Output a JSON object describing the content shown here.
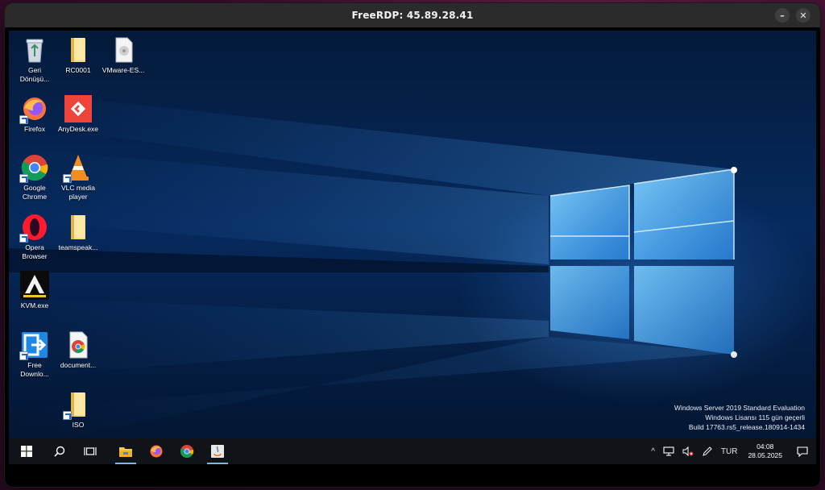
{
  "window": {
    "title": "FreeRDP: 45.89.28.41",
    "minimize_glyph": "–",
    "close_glyph": "✕"
  },
  "desktop_icons": [
    {
      "name": "recycle-bin-icon",
      "lines": [
        "Geri",
        "Dönüşü..."
      ]
    },
    {
      "name": "folder-icon",
      "lines": [
        "RC0001"
      ]
    },
    {
      "name": "file-icon",
      "lines": [
        "VMware-ES..."
      ]
    },
    {
      "name": "firefox-icon",
      "lines": [
        "Firefox"
      ]
    },
    {
      "name": "anydesk-icon",
      "lines": [
        "AnyDesk.exe"
      ]
    },
    {
      "name": "chrome-icon",
      "lines": [
        "Google",
        "Chrome"
      ]
    },
    {
      "name": "vlc-icon",
      "lines": [
        "VLC media",
        "player"
      ]
    },
    {
      "name": "opera-icon",
      "lines": [
        "Opera",
        "Browser"
      ]
    },
    {
      "name": "folder-icon",
      "lines": [
        "teamspeak..."
      ]
    },
    {
      "name": "aurora-icon",
      "lines": [
        "KVM.exe"
      ]
    },
    {
      "name": "download-icon",
      "lines": [
        "Free",
        "Downlo..."
      ]
    },
    {
      "name": "chrome-document-icon",
      "lines": [
        "document..."
      ]
    },
    {
      "name": "folder-icon",
      "lines": [
        "ISO"
      ]
    }
  ],
  "watermark": {
    "line1": "Windows Server 2019 Standard Evaluation",
    "line2": "Windows Lisansı 115 gün geçerli",
    "line3": "Build 17763.rs5_release.180914-1434"
  },
  "taskbar": {
    "apps": [
      "start-icon",
      "search-icon",
      "task-view-icon",
      "file-explorer-icon",
      "firefox-icon",
      "chrome-icon",
      "java-icon"
    ],
    "tray": {
      "chevron": "^",
      "language": "TUR",
      "time": "04:08",
      "date": "28.05.2025"
    }
  },
  "colors": {
    "accent": "#76b9ed",
    "taskbar": "#101318",
    "titlebar": "#2b2b2b"
  }
}
